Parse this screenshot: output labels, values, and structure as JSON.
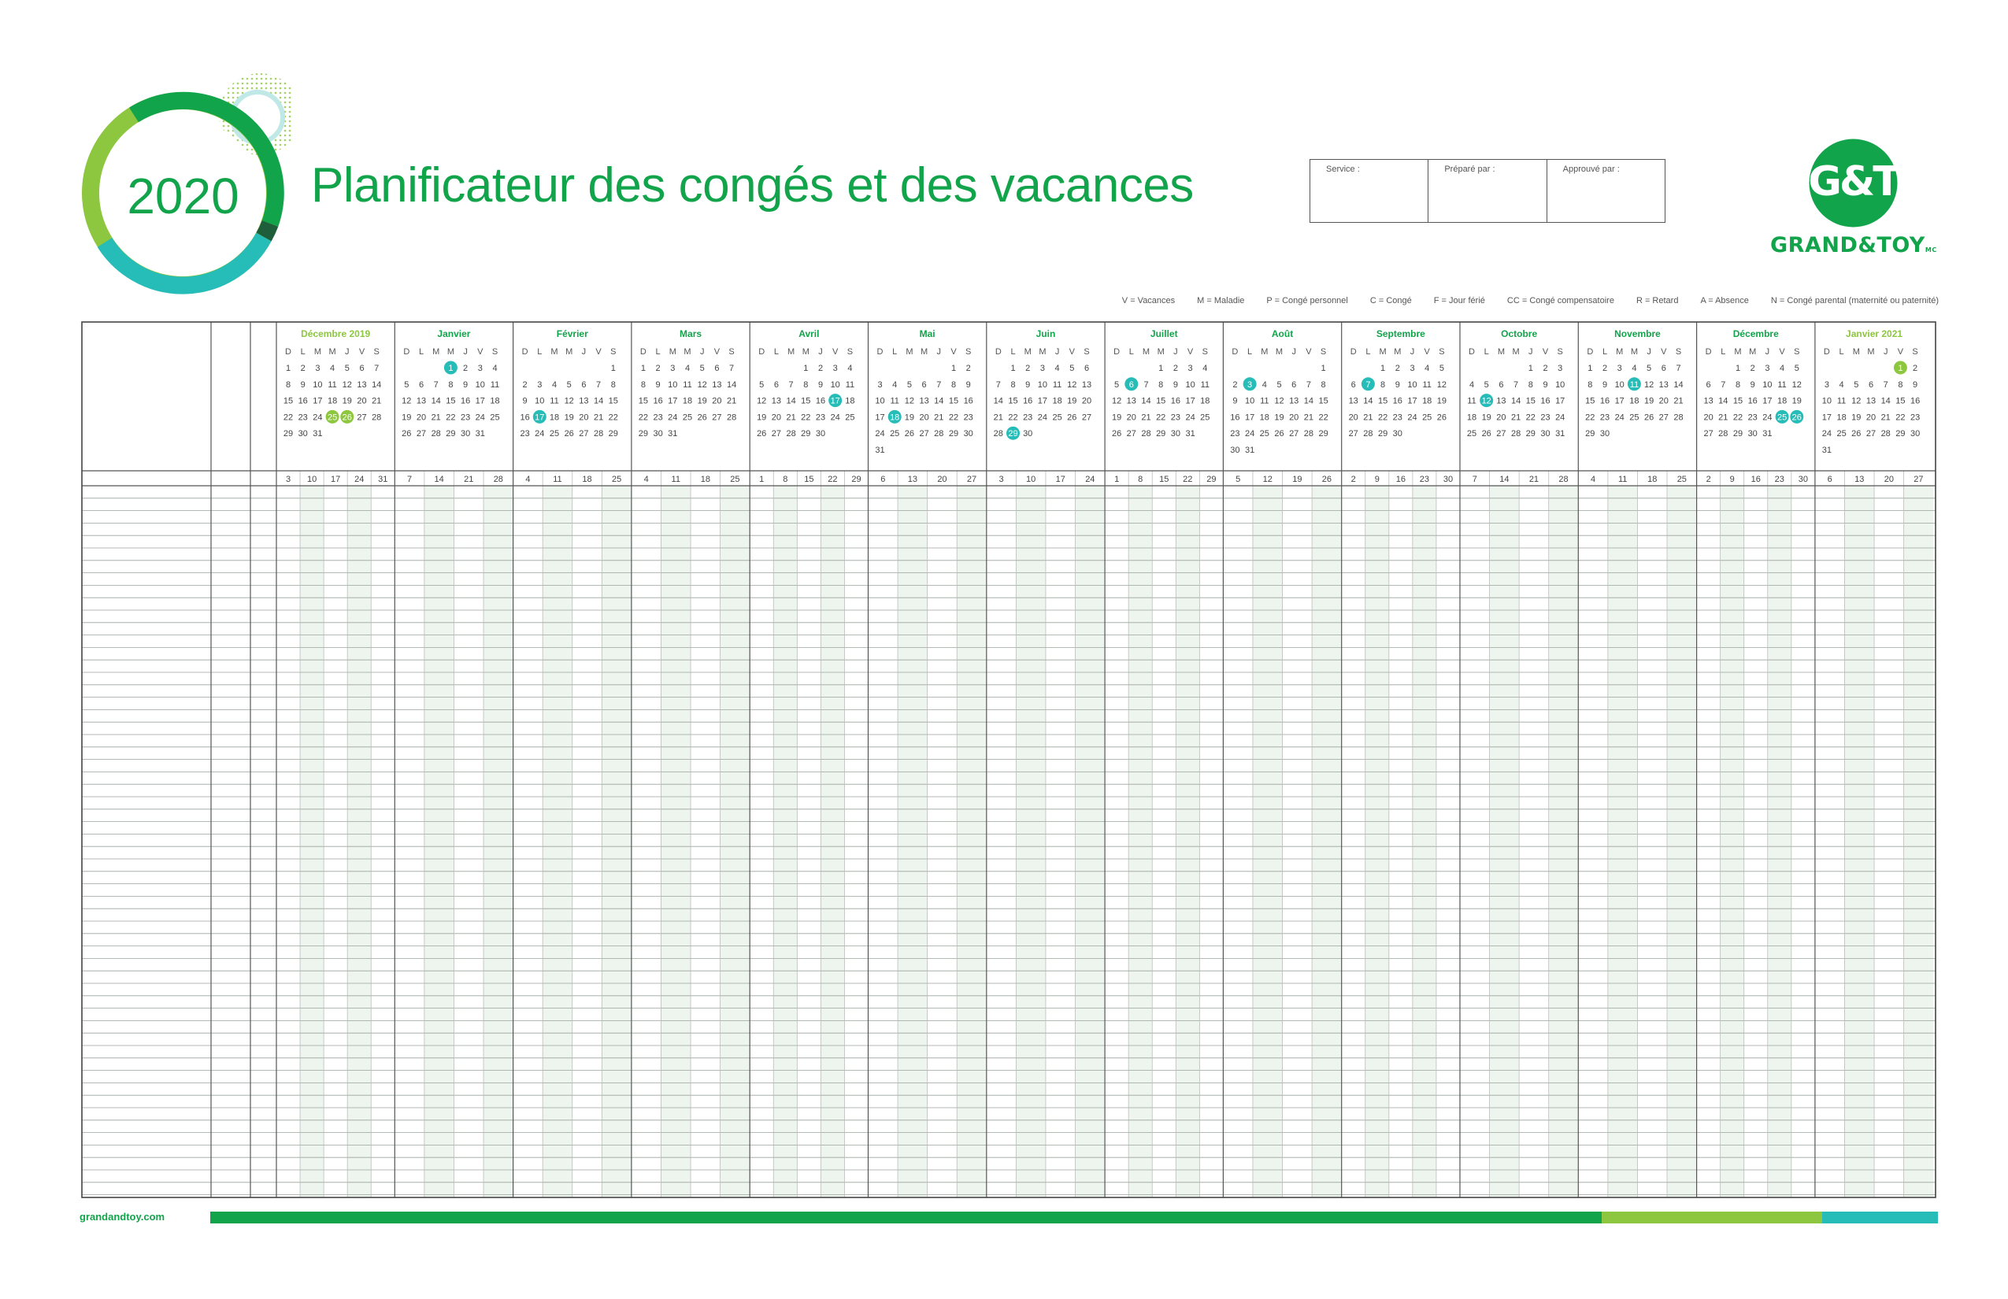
{
  "header": {
    "year": "2020",
    "title": "Planificateur des congés et des vacances",
    "signoff": [
      {
        "label": "Service :"
      },
      {
        "label": "Préparé par :"
      },
      {
        "label": "Approuvé par :"
      }
    ]
  },
  "brand": {
    "mark": "G&T",
    "wordmark": "GRAND&TOY",
    "tm": "MC",
    "green": "#12a44b",
    "lime": "#8dc63f",
    "teal": "#26bcb7",
    "dark": "#1e5e3a"
  },
  "legend": [
    "V = Vacances",
    "M = Maladie",
    "P = Congé personnel",
    "C = Congé",
    "F = Jour férié",
    "CC = Congé compensatoire",
    "R = Retard",
    "A = Absence",
    "N = Congé parental (maternité ou paternité)"
  ],
  "weekday_letters": [
    "D",
    "L",
    "M",
    "M",
    "J",
    "V",
    "S"
  ],
  "months": [
    {
      "name": "Décembre 2019",
      "first_dow": 0,
      "days": 31,
      "tone": "lime",
      "highlight": {
        "25": "lime",
        "26": "lime"
      },
      "weeks": [
        "3",
        "10",
        "17",
        "24",
        "31"
      ]
    },
    {
      "name": "Janvier",
      "first_dow": 3,
      "days": 31,
      "tone": "green",
      "highlight": {
        "1": "teal"
      },
      "weeks": [
        "7",
        "14",
        "21",
        "28"
      ]
    },
    {
      "name": "Février",
      "first_dow": 6,
      "days": 29,
      "tone": "green",
      "highlight": {
        "17": "teal"
      },
      "weeks": [
        "4",
        "11",
        "18",
        "25"
      ]
    },
    {
      "name": "Mars",
      "first_dow": 0,
      "days": 31,
      "tone": "green",
      "highlight": {},
      "weeks": [
        "4",
        "11",
        "18",
        "25"
      ]
    },
    {
      "name": "Avril",
      "first_dow": 3,
      "days": 30,
      "tone": "green",
      "highlight": {
        "17": "teal"
      },
      "weeks": [
        "1",
        "8",
        "15",
        "22",
        "29"
      ]
    },
    {
      "name": "Mai",
      "first_dow": 5,
      "days": 31,
      "tone": "green",
      "highlight": {
        "18": "teal"
      },
      "weeks": [
        "6",
        "13",
        "20",
        "27"
      ]
    },
    {
      "name": "Juin",
      "first_dow": 1,
      "days": 30,
      "tone": "green",
      "highlight": {
        "29": "teal"
      },
      "weeks": [
        "3",
        "10",
        "17",
        "24"
      ]
    },
    {
      "name": "Juillet",
      "first_dow": 3,
      "days": 31,
      "tone": "green",
      "highlight": {
        "6": "teal"
      },
      "weeks": [
        "1",
        "8",
        "15",
        "22",
        "29"
      ]
    },
    {
      "name": "Août",
      "first_dow": 6,
      "days": 31,
      "tone": "green",
      "highlight": {
        "3": "teal"
      },
      "weeks": [
        "5",
        "12",
        "19",
        "26"
      ]
    },
    {
      "name": "Septembre",
      "first_dow": 2,
      "days": 30,
      "tone": "green",
      "highlight": {
        "7": "teal"
      },
      "weeks": [
        "2",
        "9",
        "16",
        "23",
        "30"
      ]
    },
    {
      "name": "Octobre",
      "first_dow": 4,
      "days": 31,
      "tone": "green",
      "highlight": {
        "12": "teal"
      },
      "weeks": [
        "7",
        "14",
        "21",
        "28"
      ]
    },
    {
      "name": "Novembre",
      "first_dow": 0,
      "days": 30,
      "tone": "green",
      "highlight": {
        "11": "teal"
      },
      "weeks": [
        "4",
        "11",
        "18",
        "25"
      ]
    },
    {
      "name": "Décembre",
      "first_dow": 2,
      "days": 31,
      "tone": "green",
      "highlight": {
        "25": "teal",
        "26": "teal"
      },
      "weeks": [
        "2",
        "9",
        "16",
        "23",
        "30"
      ]
    },
    {
      "name": "Janvier 2021",
      "first_dow": 5,
      "days": 31,
      "tone": "lime",
      "highlight": {
        "1": "lime"
      },
      "weeks": [
        "6",
        "13",
        "20",
        "27"
      ]
    }
  ],
  "footer": {
    "url": "grandandtoy.com"
  }
}
